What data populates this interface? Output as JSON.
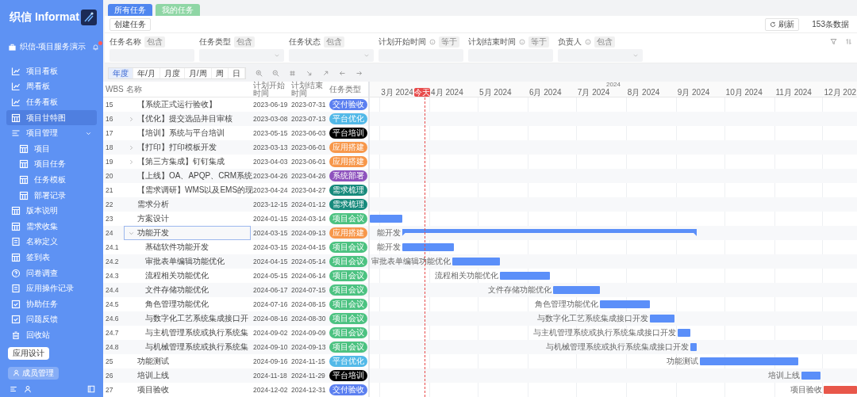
{
  "sidebar": {
    "brand": "织信 Informat",
    "workspace": "织信-项目服务演示",
    "notification": true,
    "items": [
      {
        "label": "项目看板",
        "selected": false
      },
      {
        "label": "周看板",
        "selected": false
      },
      {
        "label": "任务看板",
        "selected": false
      },
      {
        "label": "项目甘特图",
        "selected": true
      },
      {
        "label": "项目管理",
        "selected": false,
        "expanded": true,
        "children": [
          {
            "label": "项目",
            "selected": false
          },
          {
            "label": "项目任务",
            "selected": false
          },
          {
            "label": "任务模板",
            "selected": false
          },
          {
            "label": "部署记录",
            "selected": false
          }
        ]
      },
      {
        "label": "版本说明",
        "selected": false
      },
      {
        "label": "需求收集",
        "selected": false
      },
      {
        "label": "名称定义",
        "selected": false
      },
      {
        "label": "签到表",
        "selected": false
      },
      {
        "label": "问卷调查",
        "selected": false
      },
      {
        "label": "应用操作记录",
        "selected": false
      },
      {
        "label": "协助任务",
        "selected": false
      },
      {
        "label": "问题反馈",
        "selected": false
      },
      {
        "label": "回收站",
        "selected": false
      }
    ],
    "buttons": [
      "应用设计",
      "成员管理"
    ]
  },
  "tabs": [
    {
      "label": "所有任务",
      "selected": true
    },
    {
      "label": "我的任务",
      "selected": false
    }
  ],
  "toolbar": {
    "create": "创建任务",
    "refresh": "刷新",
    "count": "153条数据"
  },
  "filters": [
    {
      "label": "任务名称",
      "operator": "包含",
      "info": false,
      "kind": "text"
    },
    {
      "label": "任务类型",
      "operator": "包含",
      "info": false,
      "kind": "select"
    },
    {
      "label": "任务状态",
      "operator": "包含",
      "info": false,
      "kind": "select"
    },
    {
      "label": "计划开始时间",
      "operator": "等于",
      "info": true,
      "kind": "text"
    },
    {
      "label": "计划结束时间",
      "operator": "等于",
      "info": true,
      "kind": "text"
    },
    {
      "label": "负责人",
      "operator": "包含",
      "info": true,
      "kind": "select"
    }
  ],
  "scales": [
    {
      "label": "年度",
      "selected": true
    },
    {
      "label": "年/月",
      "selected": false
    },
    {
      "label": "月度",
      "selected": false
    },
    {
      "label": "月/周",
      "selected": false
    },
    {
      "label": "周",
      "selected": false
    },
    {
      "label": "日",
      "selected": false
    }
  ],
  "table": {
    "columns": [
      "WBS",
      "名称",
      "计划开始时间",
      "计划结束时间",
      "任务类型"
    ],
    "rows": [
      {
        "wbs": "15",
        "name": "【系统正式运行验收】",
        "start": "2023-06-19",
        "end": "2023-07-31",
        "tag": {
          "label": "交付验收",
          "color": "#5b7ff0"
        },
        "selected": false
      },
      {
        "wbs": "16",
        "name": "【优化】提交选品并目审核",
        "start": "2023-03-08",
        "end": "2023-07-13",
        "tag": {
          "label": "平台优化",
          "color": "#52b9e8"
        },
        "selected": false,
        "expanded": false
      },
      {
        "wbs": "17",
        "name": "【培训】系统与平台培训",
        "start": "2023-05-15",
        "end": "2023-06-03",
        "tag": {
          "label": "平台培训",
          "color": "#000000"
        },
        "selected": false
      },
      {
        "wbs": "18",
        "name": "【打印】打印模板开发",
        "start": "2023-03-13",
        "end": "2023-06-01",
        "tag": {
          "label": "应用搭建",
          "color": "#f7974a"
        },
        "selected": false,
        "expanded": false
      },
      {
        "wbs": "19",
        "name": "【第三方集成】钉钉集成",
        "start": "2023-04-03",
        "end": "2023-06-01",
        "tag": {
          "label": "应用搭建",
          "color": "#f7974a"
        },
        "selected": false,
        "expanded": false
      },
      {
        "wbs": "20",
        "name": "【上线】OA、APQP、CRM系统",
        "start": "2023-04-26",
        "end": "2023-04-26",
        "tag": {
          "label": "系统部署",
          "color": "#8e52bd"
        },
        "selected": false
      },
      {
        "wbs": "21",
        "name": "【需求调研】WMS以及EMS的现",
        "start": "2023-04-24",
        "end": "2023-04-27",
        "tag": {
          "label": "需求梳理",
          "color": "#178a7c"
        },
        "selected": false
      },
      {
        "wbs": "22",
        "name": "需求分析",
        "start": "2023-12-15",
        "end": "2024-01-12",
        "tag": {
          "label": "需求梳理",
          "color": "#178a7c"
        },
        "selected": false
      },
      {
        "wbs": "23",
        "name": "方案设计",
        "start": "2024-01-15",
        "end": "2024-03-14",
        "tag": {
          "label": "项目会议",
          "color": "#4cc281"
        },
        "selected": false,
        "bar": {
          "color": "#5b8ff9"
        }
      },
      {
        "wbs": "24",
        "name": "功能开发",
        "start": "2024-03-15",
        "end": "2024-09-13",
        "tag": {
          "label": "应用搭建",
          "color": "#f7974a"
        },
        "selected": true,
        "expanded": true,
        "bar": {
          "label": "能开发",
          "color": "#5b8ff9"
        },
        "children": [
          {
            "wbs": "24.1",
            "name": "基础软件功能开发",
            "start": "2024-03-15",
            "end": "2024-04-15",
            "tag": {
              "label": "项目会议",
              "color": "#4cc281"
            },
            "selected": false,
            "bar": {
              "label": "能开发",
              "color": "#5b8ff9"
            }
          },
          {
            "wbs": "24.2",
            "name": "审批表单编辑功能优化",
            "start": "2024-04-15",
            "end": "2024-05-14",
            "tag": {
              "label": "项目会议",
              "color": "#4cc281"
            },
            "selected": false,
            "bar": {
              "label": "审批表单编辑功能优化",
              "color": "#5b8ff9"
            }
          },
          {
            "wbs": "24.3",
            "name": "流程相关功能优化",
            "start": "2024-05-15",
            "end": "2024-06-14",
            "tag": {
              "label": "项目会议",
              "color": "#4cc281"
            },
            "selected": false,
            "bar": {
              "label": "流程相关功能优化",
              "color": "#5b8ff9"
            }
          },
          {
            "wbs": "24.4",
            "name": "文件存储功能优化",
            "start": "2024-06-17",
            "end": "2024-07-15",
            "tag": {
              "label": "项目会议",
              "color": "#4cc281"
            },
            "selected": false,
            "bar": {
              "label": "文件存储功能优化",
              "color": "#5b8ff9"
            }
          },
          {
            "wbs": "24.5",
            "name": "角色管理功能优化",
            "start": "2024-07-16",
            "end": "2024-08-15",
            "tag": {
              "label": "项目会议",
              "color": "#4cc281"
            },
            "selected": false,
            "bar": {
              "label": "角色管理功能优化",
              "color": "#5b8ff9"
            }
          },
          {
            "wbs": "24.6",
            "name": "与数字化工艺系统集成接口开",
            "start": "2024-08-16",
            "end": "2024-08-30",
            "tag": {
              "label": "项目会议",
              "color": "#4cc281"
            },
            "selected": false,
            "bar": {
              "label": "与数字化工艺系统集成接口开发",
              "color": "#5b8ff9"
            }
          },
          {
            "wbs": "24.7",
            "name": "与主机管理系统或执行系统集",
            "start": "2024-09-02",
            "end": "2024-09-09",
            "tag": {
              "label": "项目会议",
              "color": "#4cc281"
            },
            "selected": false,
            "bar": {
              "label": "与主机管理系统或执行系统集成接口开发",
              "color": "#5b8ff9"
            }
          },
          {
            "wbs": "24.8",
            "name": "与机械管理系统或执行系统集",
            "start": "2024-09-10",
            "end": "2024-09-13",
            "tag": {
              "label": "项目会议",
              "color": "#4cc281"
            },
            "selected": false,
            "bar": {
              "label": "与机械管理系统或执行系统集成接口开发",
              "color": "#5b8ff9"
            }
          }
        ]
      },
      {
        "wbs": "25",
        "name": "功能测试",
        "start": "2024-09-16",
        "end": "2024-11-15",
        "tag": {
          "label": "平台优化",
          "color": "#52b9e8"
        },
        "selected": false,
        "bar": {
          "label": "功能测试",
          "color": "#5b8ff9"
        }
      },
      {
        "wbs": "26",
        "name": "培训上线",
        "start": "2024-11-18",
        "end": "2024-11-29",
        "tag": {
          "label": "平台培训",
          "color": "#000000"
        },
        "selected": false,
        "bar": {
          "label": "培训上线",
          "color": "#5b8ff9"
        }
      },
      {
        "wbs": "27",
        "name": "项目验收",
        "start": "2024-12-02",
        "end": "2024-12-31",
        "tag": {
          "label": "交付验收",
          "color": "#5b7ff0"
        },
        "selected": false,
        "bar": {
          "label": "项目验收",
          "color": "#e8574a"
        }
      }
    ]
  },
  "gantt": {
    "year": "2024",
    "months": [
      "3月 2024",
      "4月 2024",
      "5月 2024",
      "6月 2024",
      "7月 2024",
      "8月 2024",
      "9月 2024",
      "10月 2024",
      "11月 2024",
      "12月 202"
    ],
    "today_label": "今天"
  }
}
